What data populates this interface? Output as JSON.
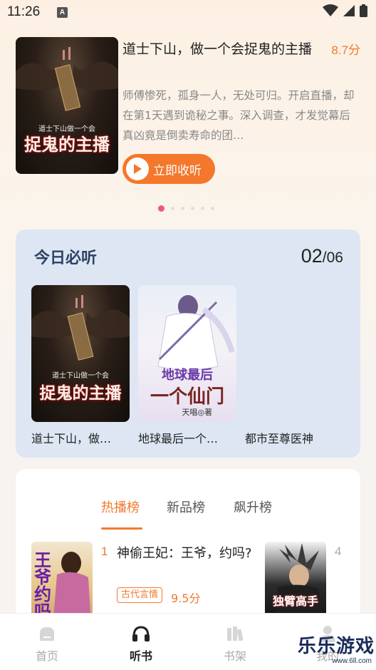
{
  "status": {
    "time": "11:26",
    "notification_badge": "A"
  },
  "featured": {
    "cover_title_art": "捉鬼的主播",
    "cover_subtitle_art": "道士下山做一个会",
    "title": "道士下山，做一个会捉鬼的主播",
    "score": "8.7分",
    "description": "师傅惨死，孤身一人，无处可归。开启直播，却在第1天遇到诡秘之事。深入调查，才发觉幕后真凶竟是倒卖寿命的团…",
    "listen_label": "立即收听",
    "dots_count": 6,
    "active_dot": 0
  },
  "daily": {
    "title": "今日必听",
    "page_current": "02",
    "page_total": "/06",
    "books": [
      {
        "name": "道士下山，做…",
        "cover_title_art": "捉鬼的主播",
        "cover_subtitle_art": "道士下山做一个会"
      },
      {
        "name": "地球最后一个…",
        "cover_title_art": "一个仙门",
        "cover_subtitle_art": "地球最后",
        "cover_author_art": "天唱◎著"
      },
      {
        "name": "都市至尊医神"
      }
    ]
  },
  "rank": {
    "tabs": [
      "热播榜",
      "新品榜",
      "飙升榜"
    ],
    "active_tab": 0,
    "items": [
      {
        "num": "1",
        "title": "神偷王妃：王爷，约吗?",
        "genre": "古代言情",
        "score": "9.5分",
        "cover_art": "王爷约吗"
      },
      {
        "num": "4",
        "cover_art": "独臂高手"
      }
    ]
  },
  "nav": {
    "items": [
      {
        "label": "首页",
        "icon": "home-icon"
      },
      {
        "label": "听书",
        "icon": "headphones-icon"
      },
      {
        "label": "书架",
        "icon": "bookshelf-icon"
      },
      {
        "label": "我的",
        "icon": "profile-icon"
      }
    ],
    "active": 1
  },
  "watermark": {
    "text": "乐乐游戏",
    "url": "www.6ll.com"
  },
  "colors": {
    "accent": "#f07a2e",
    "dot_active": "#f0558a",
    "daily_bg": "#dde6f2"
  }
}
